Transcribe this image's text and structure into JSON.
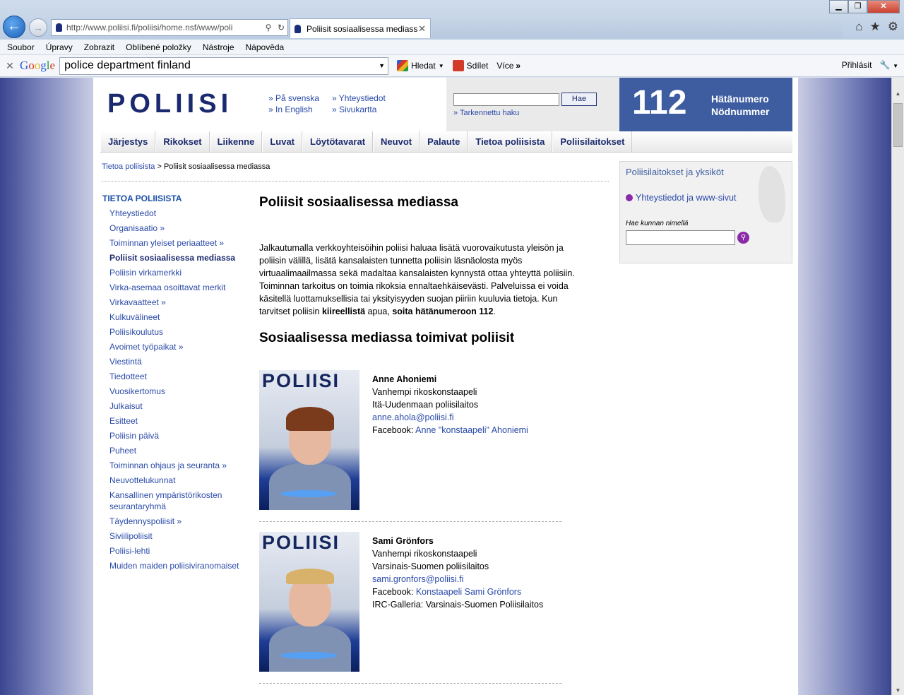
{
  "browser": {
    "url": "http://www.poliisi.fi/poliisi/home.nsf/www/poli",
    "tab_title": "Poliisit sosiaalisessa mediassa",
    "menu": [
      "Soubor",
      "Úpravy",
      "Zobrazit",
      "Oblíbené položky",
      "Nástroje",
      "Nápověda"
    ],
    "google": {
      "logo": "Google",
      "query": "police department finland",
      "search_btn": "Hledat",
      "share_btn": "Sdílet",
      "more_btn": "Více",
      "signin": "Přihlásit"
    }
  },
  "site": {
    "logo": "POLIISI",
    "links": {
      "svenska": "» På svenska",
      "english": "» In English",
      "contact": "» Yhteystiedot",
      "sitemap": "» Sivukartta"
    },
    "search": {
      "button": "Hae",
      "advanced": "» Tarkennettu haku"
    },
    "emergency": {
      "number": "112",
      "label_fi": "Hätänumero",
      "label_sv": "Nödnummer"
    },
    "nav": [
      "Järjestys",
      "Rikokset",
      "Liikenne",
      "Luvat",
      "Löytötavarat",
      "Neuvot",
      "Palaute",
      "Tietoa poliisista",
      "Poliisilaitokset"
    ],
    "breadcrumb": {
      "parent": "Tietoa poliisista",
      "sep": " > ",
      "current": "Poliisit sosiaalisessa mediassa"
    },
    "left": {
      "heading": "TIETOA POLIISISTA",
      "items": [
        {
          "label": "Yhteystiedot"
        },
        {
          "label": "Organisaatio »"
        },
        {
          "label": "Toiminnan yleiset periaatteet »"
        },
        {
          "label": "Poliisit sosiaalisessa mediassa",
          "active": true
        },
        {
          "label": "Poliisin virkamerkki"
        },
        {
          "label": "Virka-asemaa osoittavat merkit"
        },
        {
          "label": "Virkavaatteet »"
        },
        {
          "label": "Kulkuvälineet"
        },
        {
          "label": "Poliisikoulutus"
        },
        {
          "label": "Avoimet työpaikat »"
        },
        {
          "label": "Viestintä"
        },
        {
          "label": "Tiedotteet"
        },
        {
          "label": "Vuosikertomus"
        },
        {
          "label": "Julkaisut"
        },
        {
          "label": "Esitteet"
        },
        {
          "label": "Poliisin päivä"
        },
        {
          "label": "Puheet"
        },
        {
          "label": "Toiminnan ohjaus ja seuranta »"
        },
        {
          "label": "Neuvottelukunnat"
        },
        {
          "label": "Kansallinen ympäristörikosten seurantaryhmä"
        },
        {
          "label": "Täydennyspoliisit »"
        },
        {
          "label": "Siviilipoliisit"
        },
        {
          "label": "Poliisi-lehti"
        },
        {
          "label": "Muiden maiden poliisiviranomaiset"
        }
      ]
    },
    "main": {
      "title": "Poliisit sosiaalisessa mediassa",
      "intro": "Jalkautumalla verkkoyhteisöihin poliisi haluaa lisätä vuorovaikutusta yleisön ja poliisin välillä, lisätä kansalaisten tunnetta poliisin läsnäolosta myös virtuaalimaailmassa sekä madaltaa kansalaisten kynnystä ottaa yhteyttä poliisiin. Toiminnan tarkoitus on toimia rikoksia ennaltaehkäisevästi. Palveluissa ei voida käsitellä luottamuksellisia tai yksityisyyden suojan piiriin kuuluvia tietoja. Kun tarvitset poliisin ",
      "intro_b1": "kiireellistä",
      "intro_mid": " apua, ",
      "intro_b2": "soita hätänumeroon 112",
      "intro_end": ".",
      "subtitle": "Sosiaalisessa mediassa toimivat poliisit",
      "photo_logo": "POLIISI",
      "people": [
        {
          "name": "Anne Ahoniemi",
          "role": "Vanhempi rikoskonstaapeli",
          "unit": "Itä-Uudenmaan poliisilaitos",
          "email": "anne.ahola@poliisi.fi",
          "fb_label": "Facebook: ",
          "fb_link": "Anne \"konstaapeli\" Ahoniemi"
        },
        {
          "name": "Sami Grönfors",
          "role": "Vanhempi rikoskonstaapeli",
          "unit": "Varsinais-Suomen poliisilaitos",
          "email": "sami.gronfors@poliisi.fi",
          "fb_label": "Facebook: ",
          "fb_link": "Konstaapeli Sami Grönfors",
          "irc": "IRC-Galleria: Varsinais-Suomen Poliisilaitos"
        }
      ]
    },
    "right": {
      "title": "Poliisilaitokset ja yksiköt",
      "link": "Yhteystiedot ja www-sivut",
      "search_label": "Hae kunnan nimellä"
    }
  }
}
